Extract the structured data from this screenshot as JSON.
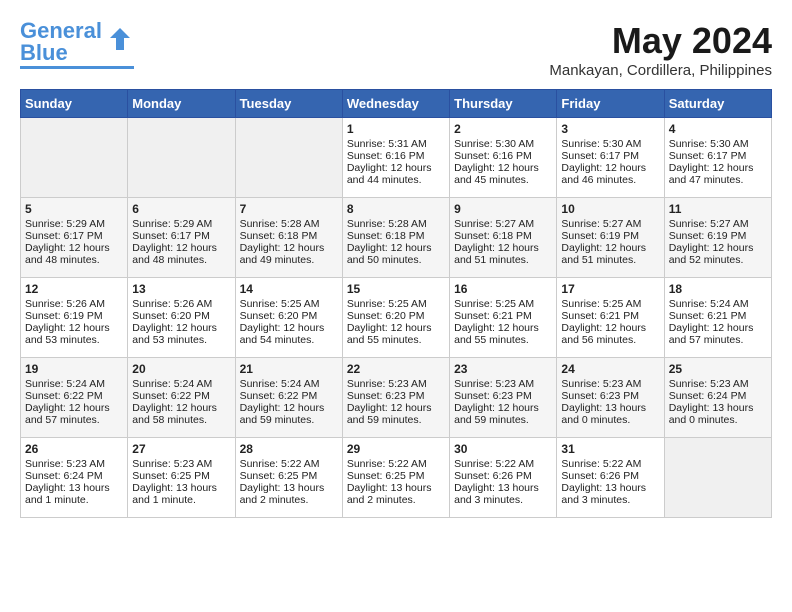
{
  "logo": {
    "line1": "General",
    "line2": "Blue"
  },
  "title": "May 2024",
  "location": "Mankayan, Cordillera, Philippines",
  "days_of_week": [
    "Sunday",
    "Monday",
    "Tuesday",
    "Wednesday",
    "Thursday",
    "Friday",
    "Saturday"
  ],
  "weeks": [
    [
      {
        "day": "",
        "sunrise": "",
        "sunset": "",
        "daylight": "",
        "empty": true
      },
      {
        "day": "",
        "sunrise": "",
        "sunset": "",
        "daylight": "",
        "empty": true
      },
      {
        "day": "",
        "sunrise": "",
        "sunset": "",
        "daylight": "",
        "empty": true
      },
      {
        "day": "1",
        "sunrise": "Sunrise: 5:31 AM",
        "sunset": "Sunset: 6:16 PM",
        "daylight": "Daylight: 12 hours and 44 minutes.",
        "empty": false
      },
      {
        "day": "2",
        "sunrise": "Sunrise: 5:30 AM",
        "sunset": "Sunset: 6:16 PM",
        "daylight": "Daylight: 12 hours and 45 minutes.",
        "empty": false
      },
      {
        "day": "3",
        "sunrise": "Sunrise: 5:30 AM",
        "sunset": "Sunset: 6:17 PM",
        "daylight": "Daylight: 12 hours and 46 minutes.",
        "empty": false
      },
      {
        "day": "4",
        "sunrise": "Sunrise: 5:30 AM",
        "sunset": "Sunset: 6:17 PM",
        "daylight": "Daylight: 12 hours and 47 minutes.",
        "empty": false
      }
    ],
    [
      {
        "day": "5",
        "sunrise": "Sunrise: 5:29 AM",
        "sunset": "Sunset: 6:17 PM",
        "daylight": "Daylight: 12 hours and 48 minutes.",
        "empty": false
      },
      {
        "day": "6",
        "sunrise": "Sunrise: 5:29 AM",
        "sunset": "Sunset: 6:17 PM",
        "daylight": "Daylight: 12 hours and 48 minutes.",
        "empty": false
      },
      {
        "day": "7",
        "sunrise": "Sunrise: 5:28 AM",
        "sunset": "Sunset: 6:18 PM",
        "daylight": "Daylight: 12 hours and 49 minutes.",
        "empty": false
      },
      {
        "day": "8",
        "sunrise": "Sunrise: 5:28 AM",
        "sunset": "Sunset: 6:18 PM",
        "daylight": "Daylight: 12 hours and 50 minutes.",
        "empty": false
      },
      {
        "day": "9",
        "sunrise": "Sunrise: 5:27 AM",
        "sunset": "Sunset: 6:18 PM",
        "daylight": "Daylight: 12 hours and 51 minutes.",
        "empty": false
      },
      {
        "day": "10",
        "sunrise": "Sunrise: 5:27 AM",
        "sunset": "Sunset: 6:19 PM",
        "daylight": "Daylight: 12 hours and 51 minutes.",
        "empty": false
      },
      {
        "day": "11",
        "sunrise": "Sunrise: 5:27 AM",
        "sunset": "Sunset: 6:19 PM",
        "daylight": "Daylight: 12 hours and 52 minutes.",
        "empty": false
      }
    ],
    [
      {
        "day": "12",
        "sunrise": "Sunrise: 5:26 AM",
        "sunset": "Sunset: 6:19 PM",
        "daylight": "Daylight: 12 hours and 53 minutes.",
        "empty": false
      },
      {
        "day": "13",
        "sunrise": "Sunrise: 5:26 AM",
        "sunset": "Sunset: 6:20 PM",
        "daylight": "Daylight: 12 hours and 53 minutes.",
        "empty": false
      },
      {
        "day": "14",
        "sunrise": "Sunrise: 5:25 AM",
        "sunset": "Sunset: 6:20 PM",
        "daylight": "Daylight: 12 hours and 54 minutes.",
        "empty": false
      },
      {
        "day": "15",
        "sunrise": "Sunrise: 5:25 AM",
        "sunset": "Sunset: 6:20 PM",
        "daylight": "Daylight: 12 hours and 55 minutes.",
        "empty": false
      },
      {
        "day": "16",
        "sunrise": "Sunrise: 5:25 AM",
        "sunset": "Sunset: 6:21 PM",
        "daylight": "Daylight: 12 hours and 55 minutes.",
        "empty": false
      },
      {
        "day": "17",
        "sunrise": "Sunrise: 5:25 AM",
        "sunset": "Sunset: 6:21 PM",
        "daylight": "Daylight: 12 hours and 56 minutes.",
        "empty": false
      },
      {
        "day": "18",
        "sunrise": "Sunrise: 5:24 AM",
        "sunset": "Sunset: 6:21 PM",
        "daylight": "Daylight: 12 hours and 57 minutes.",
        "empty": false
      }
    ],
    [
      {
        "day": "19",
        "sunrise": "Sunrise: 5:24 AM",
        "sunset": "Sunset: 6:22 PM",
        "daylight": "Daylight: 12 hours and 57 minutes.",
        "empty": false
      },
      {
        "day": "20",
        "sunrise": "Sunrise: 5:24 AM",
        "sunset": "Sunset: 6:22 PM",
        "daylight": "Daylight: 12 hours and 58 minutes.",
        "empty": false
      },
      {
        "day": "21",
        "sunrise": "Sunrise: 5:24 AM",
        "sunset": "Sunset: 6:22 PM",
        "daylight": "Daylight: 12 hours and 59 minutes.",
        "empty": false
      },
      {
        "day": "22",
        "sunrise": "Sunrise: 5:23 AM",
        "sunset": "Sunset: 6:23 PM",
        "daylight": "Daylight: 12 hours and 59 minutes.",
        "empty": false
      },
      {
        "day": "23",
        "sunrise": "Sunrise: 5:23 AM",
        "sunset": "Sunset: 6:23 PM",
        "daylight": "Daylight: 12 hours and 59 minutes.",
        "empty": false
      },
      {
        "day": "24",
        "sunrise": "Sunrise: 5:23 AM",
        "sunset": "Sunset: 6:23 PM",
        "daylight": "Daylight: 13 hours and 0 minutes.",
        "empty": false
      },
      {
        "day": "25",
        "sunrise": "Sunrise: 5:23 AM",
        "sunset": "Sunset: 6:24 PM",
        "daylight": "Daylight: 13 hours and 0 minutes.",
        "empty": false
      }
    ],
    [
      {
        "day": "26",
        "sunrise": "Sunrise: 5:23 AM",
        "sunset": "Sunset: 6:24 PM",
        "daylight": "Daylight: 13 hours and 1 minute.",
        "empty": false
      },
      {
        "day": "27",
        "sunrise": "Sunrise: 5:23 AM",
        "sunset": "Sunset: 6:25 PM",
        "daylight": "Daylight: 13 hours and 1 minute.",
        "empty": false
      },
      {
        "day": "28",
        "sunrise": "Sunrise: 5:22 AM",
        "sunset": "Sunset: 6:25 PM",
        "daylight": "Daylight: 13 hours and 2 minutes.",
        "empty": false
      },
      {
        "day": "29",
        "sunrise": "Sunrise: 5:22 AM",
        "sunset": "Sunset: 6:25 PM",
        "daylight": "Daylight: 13 hours and 2 minutes.",
        "empty": false
      },
      {
        "day": "30",
        "sunrise": "Sunrise: 5:22 AM",
        "sunset": "Sunset: 6:26 PM",
        "daylight": "Daylight: 13 hours and 3 minutes.",
        "empty": false
      },
      {
        "day": "31",
        "sunrise": "Sunrise: 5:22 AM",
        "sunset": "Sunset: 6:26 PM",
        "daylight": "Daylight: 13 hours and 3 minutes.",
        "empty": false
      },
      {
        "day": "",
        "sunrise": "",
        "sunset": "",
        "daylight": "",
        "empty": true
      }
    ]
  ]
}
